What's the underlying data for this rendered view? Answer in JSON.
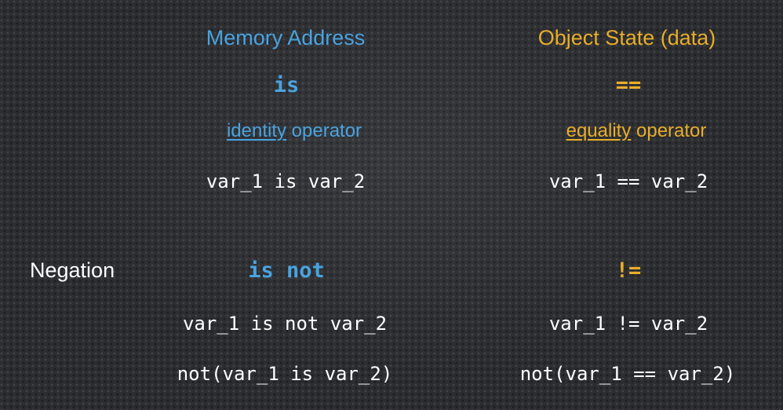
{
  "left_column": {
    "heading": "Memory Address",
    "operator": "is",
    "description_underlined": "identity",
    "description_rest": " operator",
    "example": "var_1 is var_2",
    "negation_operator": "is not",
    "negation_example_1": "var_1 is not var_2",
    "negation_example_2": "not(var_1 is var_2)"
  },
  "right_column": {
    "heading": "Object State (data)",
    "operator": "==",
    "description_underlined": "equality",
    "description_rest": " operator",
    "example": "var_1 == var_2",
    "negation_operator": "!=",
    "negation_example_1": "var_1 != var_2",
    "negation_example_2": "not(var_1 == var_2)"
  },
  "row_label": "Negation",
  "colors": {
    "left_accent": "#4aa3df",
    "right_accent": "#e8ad2a",
    "code_text": "#ffffff",
    "background": "#2b2d31"
  }
}
